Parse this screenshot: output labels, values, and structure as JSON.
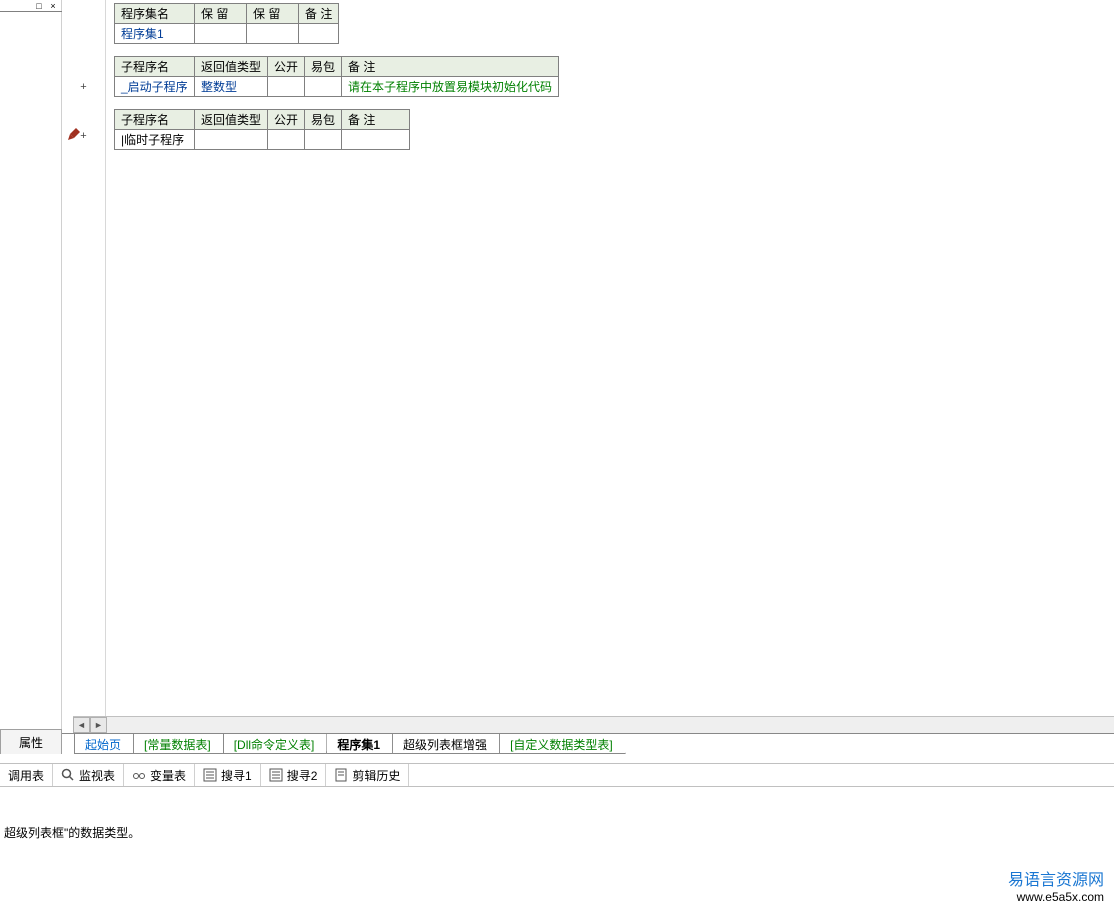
{
  "left_panel": {
    "prop_tab": "属性"
  },
  "gutter": {
    "plus1": "+",
    "plus2": "+"
  },
  "table1": {
    "headers": {
      "name": "程序集名",
      "h2": "保  留",
      "h3": "保  留",
      "h4": "备 注"
    },
    "row": {
      "name": "程序集1"
    }
  },
  "table2": {
    "headers": {
      "name": "子程序名",
      "ret": "返回值类型",
      "pub": "公开",
      "pkg": "易包",
      "rem": "备  注"
    },
    "row": {
      "name": "_启动子程序",
      "ret": "整数型",
      "rem": "请在本子程序中放置易模块初始化代码"
    }
  },
  "table3": {
    "headers": {
      "name": "子程序名",
      "ret": "返回值类型",
      "pub": "公开",
      "pkg": "易包",
      "rem": "备  注"
    },
    "row": {
      "name": "|临时子程序"
    }
  },
  "doc_tabs": {
    "t1": "起始页",
    "t2": "[常量数据表]",
    "t3": "[Dll命令定义表]",
    "t4": "程序集1",
    "t5": "超级列表框增强",
    "t6": "[自定义数据类型表]"
  },
  "tool_tabs": {
    "t1": "调用表",
    "t2": "监视表",
    "t3": "变量表",
    "t4": "搜寻1",
    "t5": "搜寻2",
    "t6": "剪辑历史"
  },
  "status": "超级列表框\"的数据类型。",
  "watermark": {
    "line1": "易语言资源网",
    "line2": "www.e5a5x.com"
  }
}
